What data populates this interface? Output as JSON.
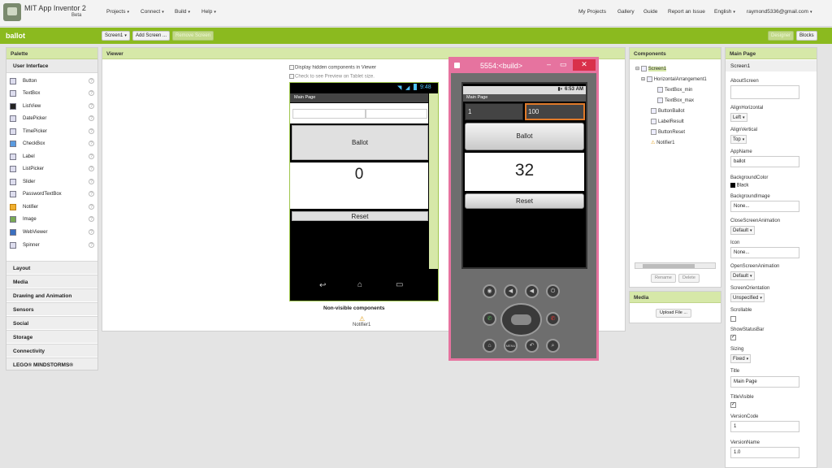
{
  "app": {
    "brand": "MIT App Inventor 2",
    "beta": "Beta",
    "menus": [
      "Projects",
      "Connect",
      "Build",
      "Help"
    ],
    "right_links": [
      "My Projects",
      "Gallery",
      "Guide",
      "Report an Issue",
      "English",
      "raymond5336@gmail.com"
    ]
  },
  "toolbar": {
    "project": "ballot",
    "screen": "Screen1",
    "add_screen": "Add Screen ...",
    "remove_screen": "Remove Screen",
    "designer": "Designer",
    "blocks": "Blocks"
  },
  "palette": {
    "title": "Palette",
    "section": "User Interface",
    "items": [
      "Button",
      "TextBox",
      "ListView",
      "DatePicker",
      "TimePicker",
      "CheckBox",
      "Label",
      "ListPicker",
      "Slider",
      "PasswordTextBox",
      "Notifier",
      "Image",
      "WebViewer",
      "Spinner"
    ],
    "help": "?",
    "categories": [
      "Layout",
      "Media",
      "Drawing and Animation",
      "Sensors",
      "Social",
      "Storage",
      "Connectivity",
      "LEGO® MINDSTORMS®"
    ]
  },
  "viewer": {
    "title": "Viewer",
    "show_hidden": "Display hidden components in Viewer",
    "tablet": "Check to see Preview on Tablet size.",
    "time": "9:48",
    "screen_title": "Main Page",
    "button": "Ballot",
    "label": "0",
    "reset": "Reset",
    "nonvisible": "Non-visible components",
    "notifier": "Notifier1"
  },
  "emulator": {
    "title": "5554:<build>",
    "time": "6:53",
    "am": "AM",
    "screen_title": "Main Page",
    "min": "1",
    "max": "100",
    "button": "Ballot",
    "result": "32",
    "reset": "Reset",
    "menu": "MENU"
  },
  "components": {
    "title": "Components",
    "tree": [
      "Screen1",
      "HorizontalArrangement1",
      "TextBox_min",
      "TextBox_max",
      "ButtonBallot",
      "LabelResult",
      "ButtonReset",
      "Notifier1"
    ],
    "rename": "Rename",
    "delete": "Delete"
  },
  "media": {
    "title": "Media",
    "upload": "Upload File ..."
  },
  "properties": {
    "title": "Main Page",
    "screen": "Screen1",
    "about_label": "AboutScreen",
    "about": "",
    "align_h_label": "AlignHorizontal",
    "align_h": "Left",
    "align_v_label": "AlignVertical",
    "align_v": "Top",
    "appname_label": "AppName",
    "appname": "ballot",
    "bgcolor_label": "BackgroundColor",
    "bgcolor": "Black",
    "bgimage_label": "BackgroundImage",
    "bgimage": "None...",
    "closeanim_label": "CloseScreenAnimation",
    "closeanim": "Default",
    "icon_label": "Icon",
    "icon": "None...",
    "openanim_label": "OpenScreenAnimation",
    "openanim": "Default",
    "orient_label": "ScreenOrientation",
    "orient": "Unspecified",
    "scrollable_label": "Scrollable",
    "statusbar_label": "ShowStatusBar",
    "sizing_label": "Sizing",
    "sizing": "Fixed",
    "title_label": "Title",
    "titlevisible_label": "TitleVisible",
    "vcode_label": "VersionCode",
    "vcode": "1",
    "vname_label": "VersionName",
    "vname": "1.0"
  },
  "colors": {
    "accent": "#8bba1f",
    "panel_head": "#d6e8a8",
    "emulator_frame": "#e6739f",
    "emulator_field_highlight": "#e07a2a"
  }
}
